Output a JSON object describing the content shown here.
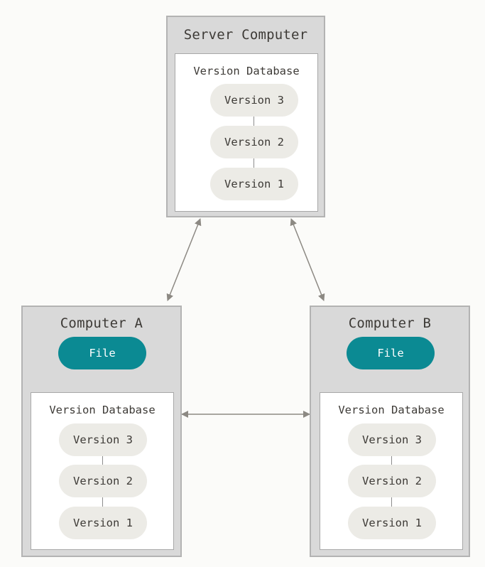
{
  "server": {
    "title": "Server Computer",
    "database": {
      "title": "Version Database",
      "versions": [
        "Version 3",
        "Version 2",
        "Version 1"
      ]
    }
  },
  "computer_a": {
    "title": "Computer A",
    "file_label": "File",
    "database": {
      "title": "Version Database",
      "versions": [
        "Version 3",
        "Version 2",
        "Version 1"
      ]
    }
  },
  "computer_b": {
    "title": "Computer B",
    "file_label": "File",
    "database": {
      "title": "Version Database",
      "versions": [
        "Version 3",
        "Version 2",
        "Version 1"
      ]
    }
  },
  "colors": {
    "background": "#fbfbf9",
    "computer_fill": "#d9d9d9",
    "computer_border": "#b3b3b3",
    "version_fill": "#ecebe6",
    "file_fill": "#0b8a93",
    "arrow": "#8c8983"
  }
}
